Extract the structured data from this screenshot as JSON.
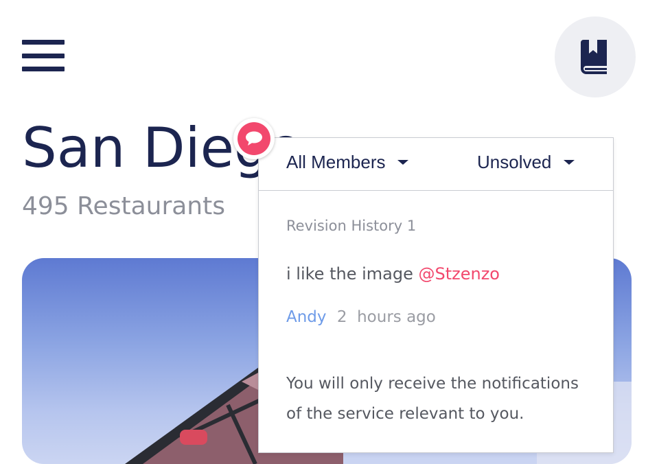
{
  "header": {
    "menu_icon": "hamburger-menu-icon",
    "bookmark_icon": "book-icon"
  },
  "page": {
    "title": "San Diego",
    "subtitle": "495 Restaurants"
  },
  "comment_badge": {
    "icon": "chat-bubble-icon",
    "color": "#f2486d"
  },
  "popover": {
    "members_filter": "All Members",
    "status_filter": "Unsolved",
    "revision_label": "Revision History 1",
    "comment": {
      "text": "i like the image",
      "mention": "@Stzenzo",
      "author": "Andy",
      "time": "2  hours ago"
    },
    "notice": "You will only receive the notifications of the service relevant to you."
  },
  "colors": {
    "primary": "#1c2550",
    "accent": "#f2486d",
    "link": "#6e9be8",
    "muted": "#8c8f99"
  }
}
